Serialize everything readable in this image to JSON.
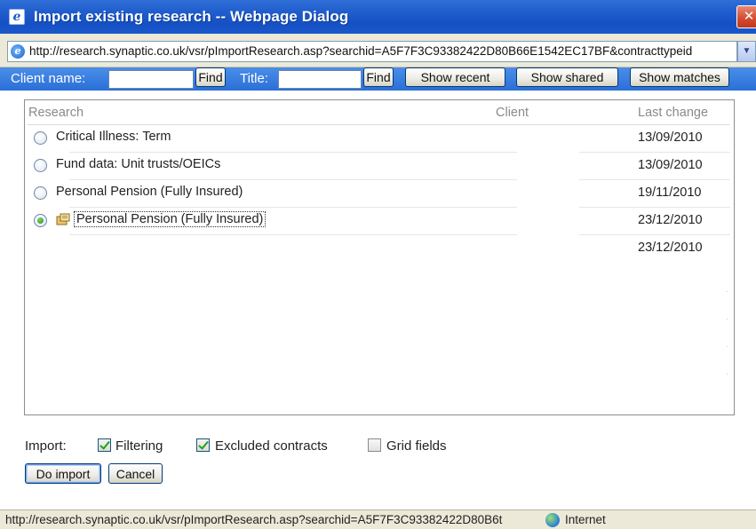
{
  "window": {
    "title": "Import existing research -- Webpage Dialog",
    "close_label": "✕"
  },
  "address": {
    "url": "http://research.synaptic.co.uk/vsr/pImportResearch.asp?searchid=A5F7F3C93382422D80B66E1542EC17BF&contracttypeid"
  },
  "filters": {
    "client_label": "Client name:",
    "client_value": "",
    "find_label": "Find",
    "title_label": "Title:",
    "title_value": "",
    "show_recent_label": "Show recent",
    "show_shared_label": "Show shared",
    "show_matches_label": "Show matches"
  },
  "list": {
    "columns": [
      "Research",
      "Client",
      "Last change"
    ],
    "rows": [
      {
        "name": "Critical Illness: Term",
        "client": "",
        "date": "13/09/2010",
        "selected": false
      },
      {
        "name": "Fund data: Unit trusts/OEICs",
        "client": "",
        "date": "13/09/2010",
        "selected": false
      },
      {
        "name": "Personal Pension (Fully Insured)",
        "client": "",
        "date": "19/11/2010",
        "selected": false
      },
      {
        "name": "Personal Pension (Fully Insured)",
        "client": "",
        "date": "23/12/2010",
        "selected": true
      },
      {
        "name": "",
        "client": "",
        "date": "23/12/2010",
        "selected": false
      }
    ]
  },
  "import_options": {
    "label": "Import:",
    "options": [
      {
        "label": "Filtering",
        "checked": true
      },
      {
        "label": "Excluded contracts",
        "checked": true
      },
      {
        "label": "Grid fields",
        "checked": false
      }
    ]
  },
  "actions": {
    "do_import_label": "Do import",
    "cancel_label": "Cancel"
  },
  "status": {
    "url": "http://research.synaptic.co.uk/vsr/pImportResearch.asp?searchid=A5F7F3C93382422D80B6t",
    "zone": "Internet"
  },
  "colors": {
    "titlebar": "#1e5bcc",
    "filterbar": "#2a6fd8",
    "checkmark": "#21a121"
  }
}
